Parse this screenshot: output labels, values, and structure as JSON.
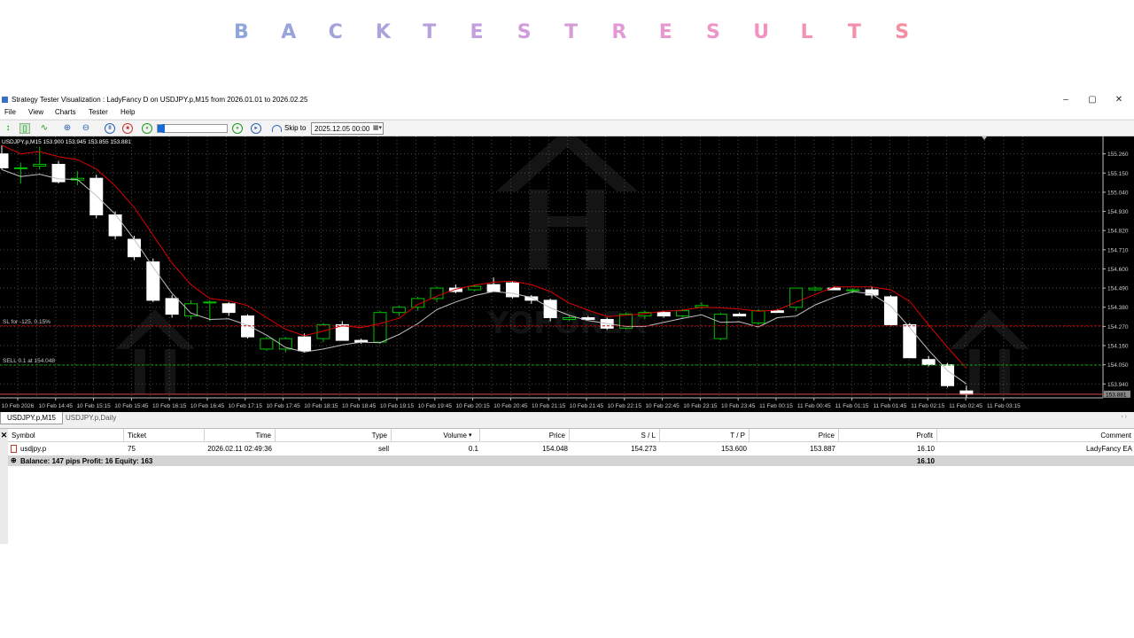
{
  "banner": {
    "letters": [
      "B",
      "A",
      "C",
      "K",
      "T",
      "E",
      "S",
      "T",
      "R",
      "E",
      "S",
      "U",
      "L",
      "T",
      "S"
    ],
    "colors": [
      "#8ea6da",
      "#98a4db",
      "#a3a3dc",
      "#aea1dc",
      "#b9a0dd",
      "#c39fdd",
      "#cf9ddc",
      "#d89bda",
      "#e29ad6",
      "#e898d0",
      "#ed96c8",
      "#f094bf",
      "#f292b4",
      "#f390aa",
      "#f48ea0"
    ]
  },
  "window": {
    "title": "Strategy Tester Visualization : LadyFancy D on USDJPY.p,M15 from 2026.01.01 to 2026.02.25",
    "minimize": "–",
    "maximize": "▢",
    "close": "✕"
  },
  "menu": [
    "File",
    "View",
    "Charts",
    "Tester",
    "Help"
  ],
  "toolbar": {
    "skip_label": "Skip to",
    "skip_value": "2025.12.05 00:00",
    "speed_fraction": 0.06
  },
  "chart": {
    "symbol_info": "USDJPY.p,M15  153.900 153.945 153.855 153.881",
    "sl_label": "SL for -125,  0.15%",
    "sell_label": "SELL 0.1 at 154.048",
    "current_price": "153.881",
    "watermark": "YOFOREX",
    "colors": {
      "up": "#00c000",
      "down": "#ffffff",
      "ma_fast": "#e00000",
      "ma_slow": "#c0c0c0",
      "grid": "#4a4a4a",
      "sl_line": "#c00000",
      "entry_line": "#00a000"
    }
  },
  "chart_data": {
    "type": "candlestick",
    "y_ticks": [
      "155.260",
      "155.150",
      "155.040",
      "154.930",
      "154.820",
      "154.710",
      "154.600",
      "154.490",
      "154.380",
      "154.270",
      "154.160",
      "154.050",
      "153.940"
    ],
    "x_labels": [
      "10 Feb 2026",
      "10 Feb 14:45",
      "10 Feb 15:15",
      "10 Feb 15:45",
      "10 Feb 16:15",
      "10 Feb 16:45",
      "10 Feb 17:15",
      "10 Feb 17:45",
      "10 Feb 18:15",
      "10 Feb 18:45",
      "10 Feb 19:15",
      "10 Feb 19:45",
      "10 Feb 20:15",
      "10 Feb 20:45",
      "10 Feb 21:15",
      "10 Feb 21:45",
      "10 Feb 22:15",
      "10 Feb 22:45",
      "10 Feb 23:15",
      "10 Feb 23:45",
      "11 Feb 00:15",
      "11 Feb 00:45",
      "11 Feb 01:15",
      "11 Feb 01:45",
      "11 Feb 02:15",
      "11 Feb 02:45",
      "11 Feb 03:15"
    ],
    "ylim": [
      153.86,
      155.36
    ],
    "sl_price": 154.273,
    "entry_price": 154.048,
    "current_price": 153.881,
    "candles": [
      [
        155.26,
        155.31,
        155.17,
        155.18
      ],
      [
        155.18,
        155.21,
        155.09,
        155.18
      ],
      [
        155.19,
        155.3,
        155.17,
        155.2
      ],
      [
        155.2,
        155.22,
        155.09,
        155.1
      ],
      [
        155.11,
        155.16,
        155.08,
        155.12
      ],
      [
        155.12,
        155.14,
        154.89,
        154.91
      ],
      [
        154.91,
        154.93,
        154.77,
        154.79
      ],
      [
        154.77,
        154.79,
        154.65,
        154.67
      ],
      [
        154.64,
        154.66,
        154.41,
        154.42
      ],
      [
        154.43,
        154.45,
        154.32,
        154.34
      ],
      [
        154.33,
        154.42,
        154.31,
        154.4
      ],
      [
        154.41,
        154.42,
        154.3,
        154.41
      ],
      [
        154.4,
        154.41,
        154.33,
        154.35
      ],
      [
        154.33,
        154.34,
        154.2,
        154.21
      ],
      [
        154.14,
        154.21,
        154.13,
        154.2
      ],
      [
        154.14,
        154.21,
        154.12,
        154.2
      ],
      [
        154.21,
        154.23,
        154.12,
        154.13
      ],
      [
        154.2,
        154.29,
        154.18,
        154.28
      ],
      [
        154.28,
        154.3,
        154.19,
        154.19
      ],
      [
        154.19,
        154.2,
        154.17,
        154.18
      ],
      [
        154.18,
        154.36,
        154.17,
        154.35
      ],
      [
        154.35,
        154.39,
        154.33,
        154.38
      ],
      [
        154.38,
        154.44,
        154.36,
        154.43
      ],
      [
        154.43,
        154.5,
        154.41,
        154.49
      ],
      [
        154.49,
        154.51,
        154.46,
        154.47
      ],
      [
        154.48,
        154.51,
        154.47,
        154.5
      ],
      [
        154.51,
        154.55,
        154.48,
        154.47
      ],
      [
        154.52,
        154.53,
        154.43,
        154.44
      ],
      [
        154.44,
        154.45,
        154.4,
        154.42
      ],
      [
        154.42,
        154.43,
        154.3,
        154.32
      ],
      [
        154.31,
        154.33,
        154.3,
        154.32
      ],
      [
        154.32,
        154.33,
        154.31,
        154.31
      ],
      [
        154.31,
        154.32,
        154.25,
        154.26
      ],
      [
        154.26,
        154.35,
        154.25,
        154.34
      ],
      [
        154.33,
        154.36,
        154.31,
        154.35
      ],
      [
        154.35,
        154.36,
        154.32,
        154.33
      ],
      [
        154.33,
        154.37,
        154.32,
        154.36
      ],
      [
        154.38,
        154.41,
        154.37,
        154.39
      ],
      [
        154.2,
        154.35,
        154.19,
        154.34
      ],
      [
        154.34,
        154.35,
        154.33,
        154.33
      ],
      [
        154.29,
        154.37,
        154.28,
        154.36
      ],
      [
        154.36,
        154.37,
        154.35,
        154.35
      ],
      [
        154.38,
        154.49,
        154.36,
        154.49
      ],
      [
        154.48,
        154.5,
        154.47,
        154.49
      ],
      [
        154.49,
        154.5,
        154.48,
        154.48
      ],
      [
        154.48,
        154.49,
        154.46,
        154.48
      ],
      [
        154.48,
        154.5,
        154.43,
        154.45
      ],
      [
        154.44,
        154.45,
        154.27,
        154.28
      ],
      [
        154.28,
        154.29,
        154.09,
        154.09
      ],
      [
        154.08,
        154.1,
        154.04,
        154.05
      ],
      [
        154.05,
        154.06,
        153.92,
        153.93
      ],
      [
        153.9,
        153.93,
        153.86,
        153.88
      ]
    ]
  },
  "tabs": [
    "USDJPY.p,M15",
    "USDJPY.p,Daily"
  ],
  "table": {
    "headers": [
      "Symbol",
      "Ticket",
      "Time",
      "Type",
      "Volume",
      "Price",
      "S / L",
      "T / P",
      "Price",
      "Profit",
      "Comment"
    ],
    "row": [
      "usdjpy.p",
      "75",
      "2026.02.11 02:49:36",
      "sell",
      "0.1",
      "154.048",
      "154.273",
      "153.600",
      "153.887",
      "16.10",
      "LadyFancy EA"
    ],
    "balance": "Balance: 147 pips   Profit: 16   Equity: 163",
    "total_profit": "16.10",
    "sort_arrow": "▾",
    "close_glyph": "✕"
  }
}
